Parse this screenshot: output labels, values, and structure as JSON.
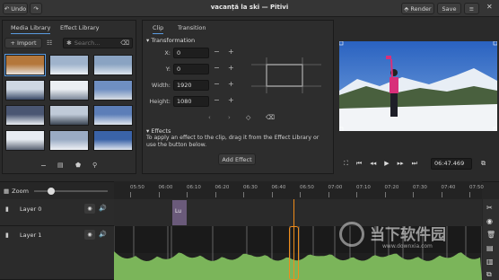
{
  "header": {
    "undo_label": "Undo",
    "title": "vacanță la ski — Pitivi",
    "render_label": "Render",
    "save_label": "Save"
  },
  "left_panel": {
    "tabs": [
      "Media Library",
      "Effect Library"
    ],
    "import_label": "Import",
    "search_placeholder": "Search..."
  },
  "clip_panel": {
    "tabs": [
      "Clip",
      "Transition"
    ],
    "transformation_header": "Transformation",
    "fields": [
      {
        "label": "X:",
        "value": "0"
      },
      {
        "label": "Y:",
        "value": "0"
      },
      {
        "label": "Width:",
        "value": "1920"
      },
      {
        "label": "Height:",
        "value": "1080"
      }
    ],
    "effects_header": "Effects",
    "effects_help": "To apply an effect to the clip, drag it from the Effect Library or use the button below.",
    "add_effect_label": "Add Effect"
  },
  "viewer": {
    "timecode": "06:47.469"
  },
  "timeline": {
    "zoom_label": "Zoom",
    "ruler_ticks": [
      "05:50",
      "06:00",
      "06:10",
      "06:20",
      "06:30",
      "06:40",
      "06:50",
      "07:00",
      "07:10",
      "07:20",
      "07:30",
      "07:40",
      "07:50"
    ],
    "layers": [
      {
        "name": "Layer 0"
      },
      {
        "name": "Layer 1"
      }
    ],
    "clip_label": "Lu"
  },
  "watermark": {
    "text": "当下软件园",
    "url": "www.downxia.com"
  },
  "colors": {
    "accent": "#5a9be0",
    "audio_wave": "#7bb55a",
    "playhead": "#f08c1a",
    "title_clip": "#6a5a7a"
  }
}
